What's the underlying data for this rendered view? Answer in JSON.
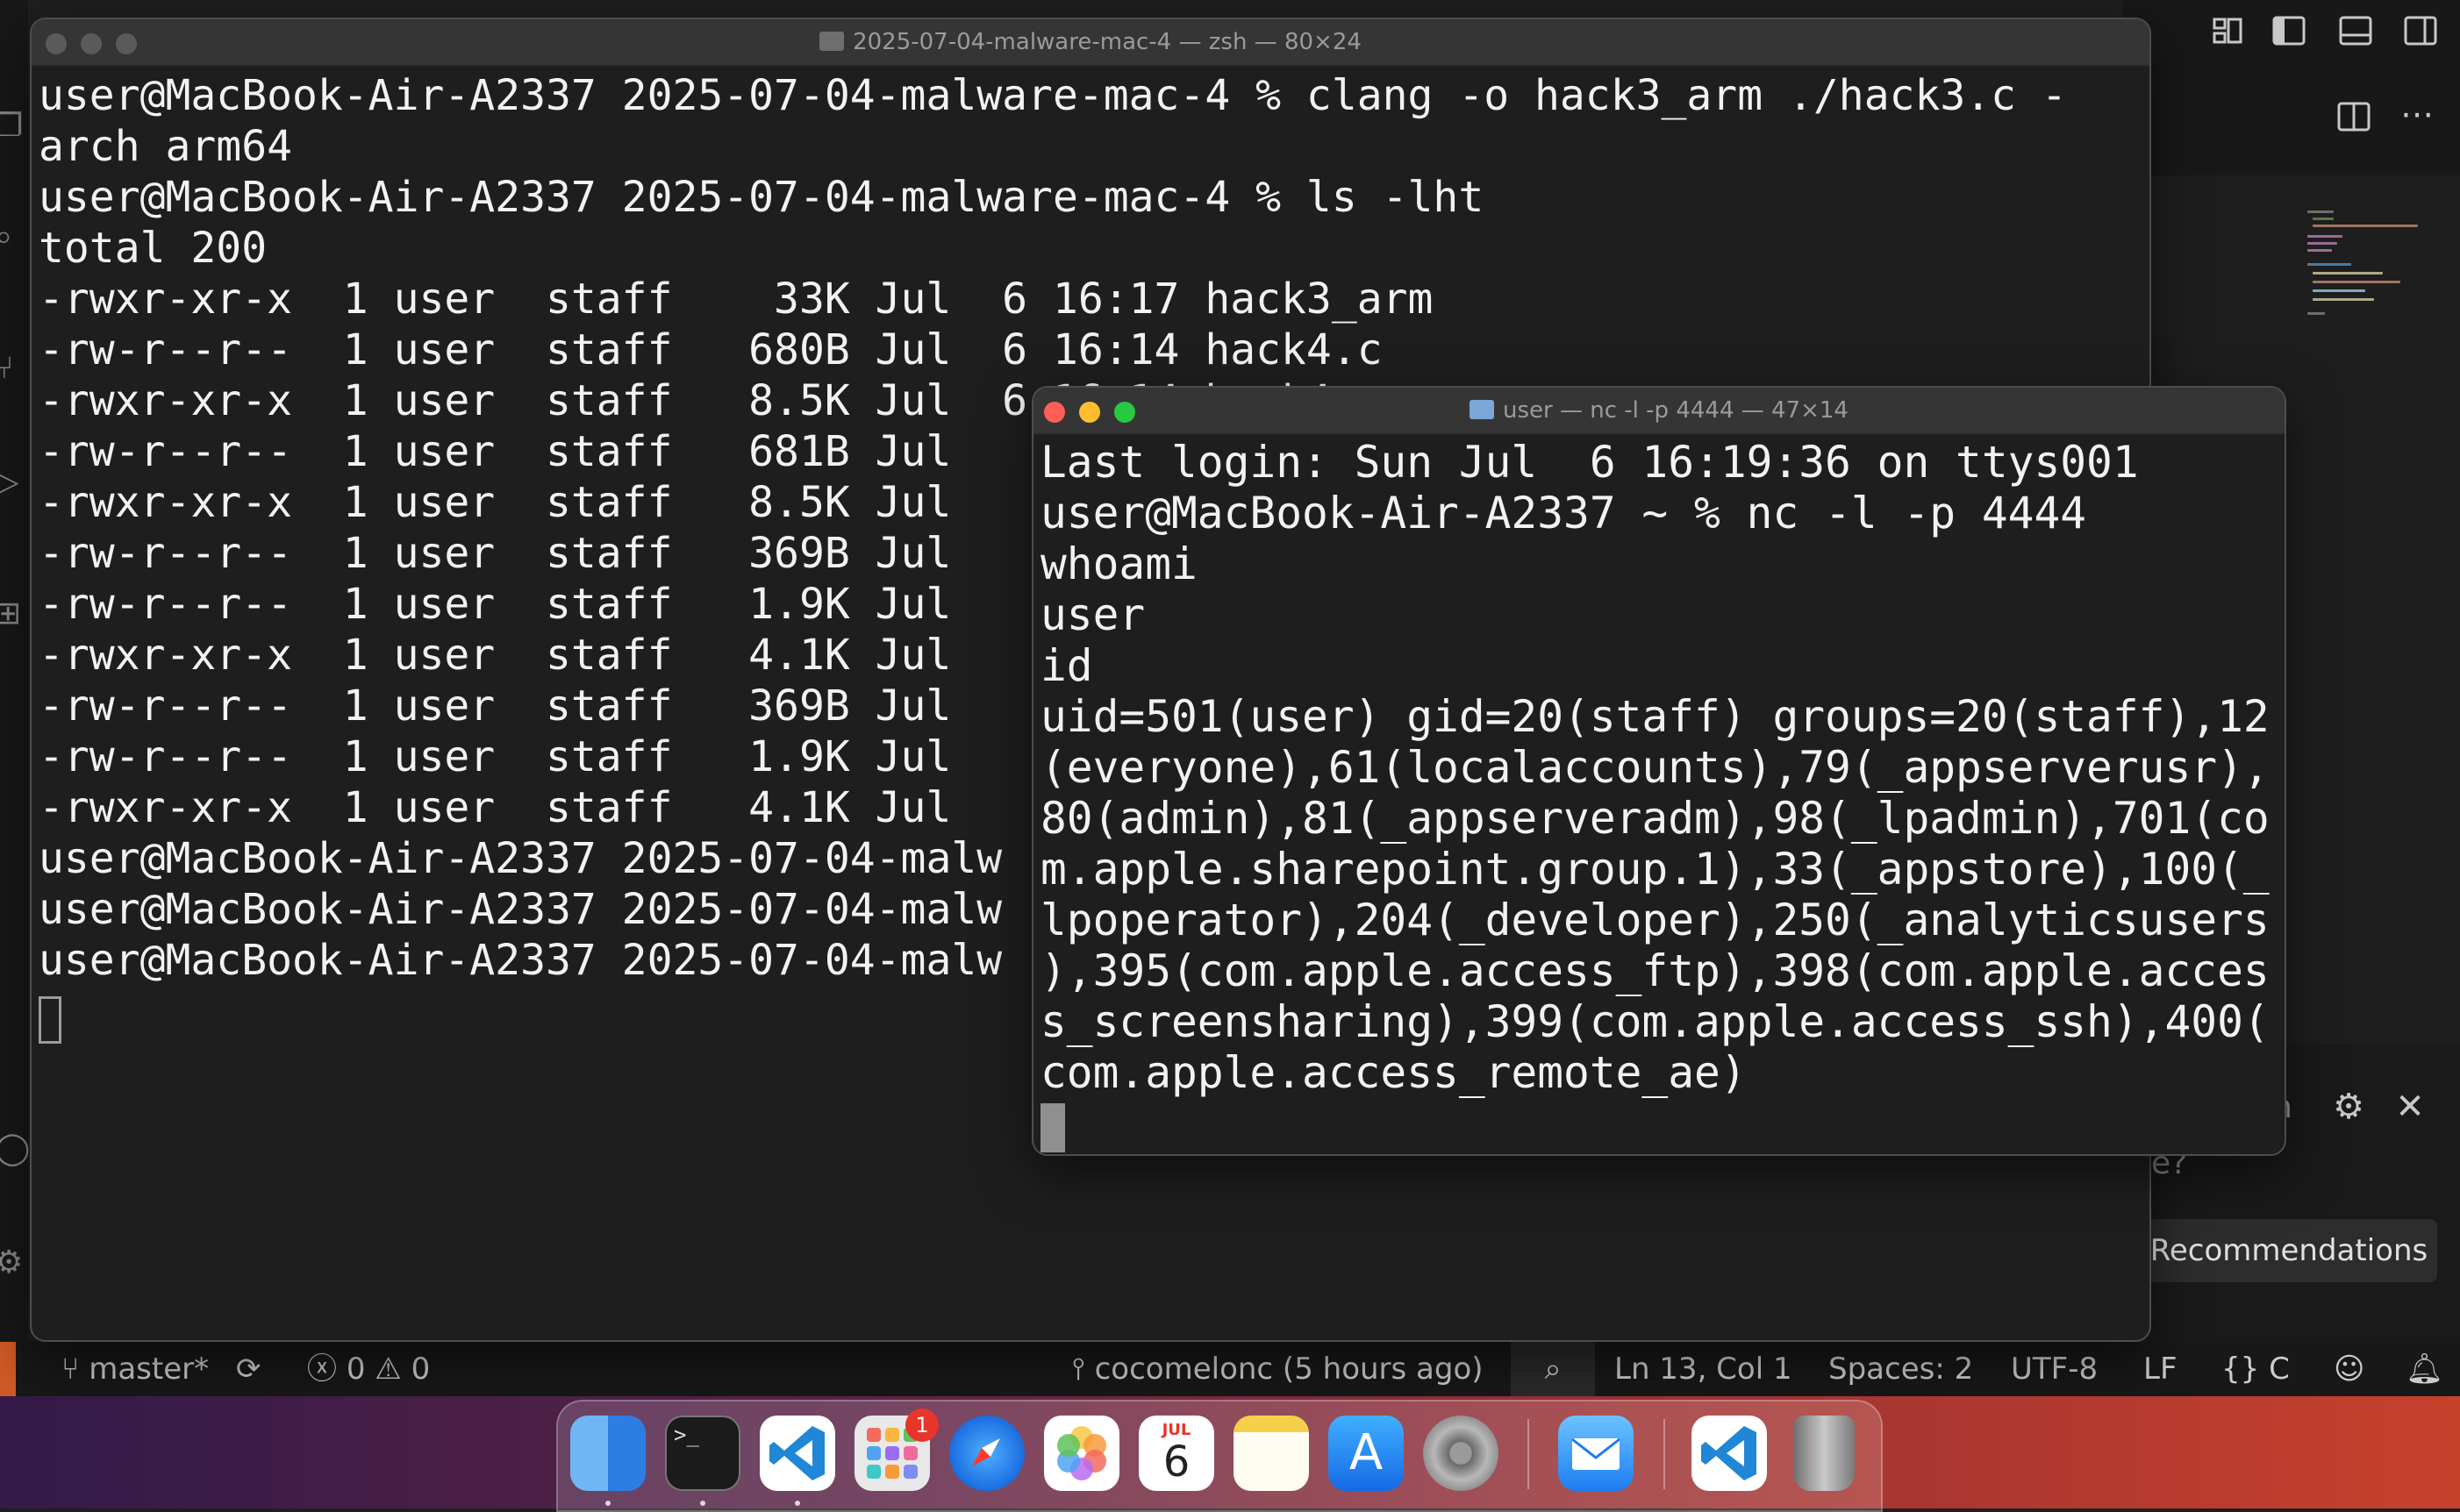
{
  "vscode": {
    "statusbar": {
      "branch": "master*",
      "errors": "0",
      "warnings": "0",
      "blame": "cocomelonc (5 hours ago)",
      "cursor_position": "Ln 13, Col 1",
      "indentation": "Spaces: 2",
      "encoding": "UTF-8",
      "eol": "LF",
      "language": "C"
    },
    "chat": {
      "fragment_1": "n",
      "fragment_2": "e?",
      "recommendations_button": "Recommendations"
    }
  },
  "terminal_main": {
    "title": "2025-07-04-malware-mac-4 — zsh — 80×24",
    "lines": [
      "user@MacBook-Air-A2337 2025-07-04-malware-mac-4 % clang -o hack3_arm ./hack3.c -",
      "arch arm64",
      "user@MacBook-Air-A2337 2025-07-04-malware-mac-4 % ls -lht",
      "total 200",
      "-rwxr-xr-x  1 user  staff    33K Jul  6 16:17 hack3_arm",
      "-rw-r--r--  1 user  staff   680B Jul  6 16:14 hack4.c",
      "-rwxr-xr-x  1 user  staff   8.5K Jul  6 16:14 hack4",
      "-rw-r--r--  1 user  staff   681B Jul",
      "-rwxr-xr-x  1 user  staff   8.5K Jul",
      "-rw-r--r--  1 user  staff   369B Jul",
      "-rw-r--r--  1 user  staff   1.9K Jul",
      "-rwxr-xr-x  1 user  staff   4.1K Jul",
      "-rw-r--r--  1 user  staff   369B Jul",
      "-rw-r--r--  1 user  staff   1.9K Jul",
      "-rwxr-xr-x  1 user  staff   4.1K Jul",
      "user@MacBook-Air-A2337 2025-07-04-malw",
      "user@MacBook-Air-A2337 2025-07-04-malw",
      "user@MacBook-Air-A2337 2025-07-04-malw"
    ]
  },
  "terminal_nc": {
    "title": "user — nc -l -p 4444 — 47×14",
    "lines": [
      "Last login: Sun Jul  6 16:19:36 on ttys001",
      "user@MacBook-Air-A2337 ~ % nc -l -p 4444",
      "whoami",
      "user",
      "id",
      "uid=501(user) gid=20(staff) groups=20(staff),12",
      "(everyone),61(localaccounts),79(_appserverusr),",
      "80(admin),81(_appserveradm),98(_lpadmin),701(co",
      "m.apple.sharepoint.group.1),33(_appstore),100(_",
      "lpoperator),204(_developer),250(_analyticsusers",
      "),395(com.apple.access_ftp),398(com.apple.acces",
      "s_screensharing),399(com.apple.access_ssh),400(",
      "com.apple.access_remote_ae)"
    ]
  },
  "dock": {
    "apps": [
      {
        "name": "Finder",
        "icon": "finder-icon"
      },
      {
        "name": "Terminal",
        "icon": "terminal-icon"
      },
      {
        "name": "Visual Studio Code",
        "icon": "vscode-icon"
      },
      {
        "name": "Launchpad",
        "icon": "launchpad-icon"
      },
      {
        "name": "Safari",
        "icon": "safari-icon"
      },
      {
        "name": "Photos",
        "icon": "photos-icon"
      },
      {
        "name": "Calendar",
        "icon": "calendar-icon"
      },
      {
        "name": "Notes",
        "icon": "notes-icon"
      },
      {
        "name": "App Store",
        "icon": "app-store-icon"
      },
      {
        "name": "System Settings",
        "icon": "system-settings-icon"
      },
      {
        "name": "Mail",
        "icon": "mail-icon"
      },
      {
        "name": "Visual Studio Code",
        "icon": "vscode-icon"
      },
      {
        "name": "Trash",
        "icon": "trash-icon"
      }
    ],
    "calendar_month": "JUL",
    "calendar_day": "6",
    "settings_badge": "1"
  }
}
